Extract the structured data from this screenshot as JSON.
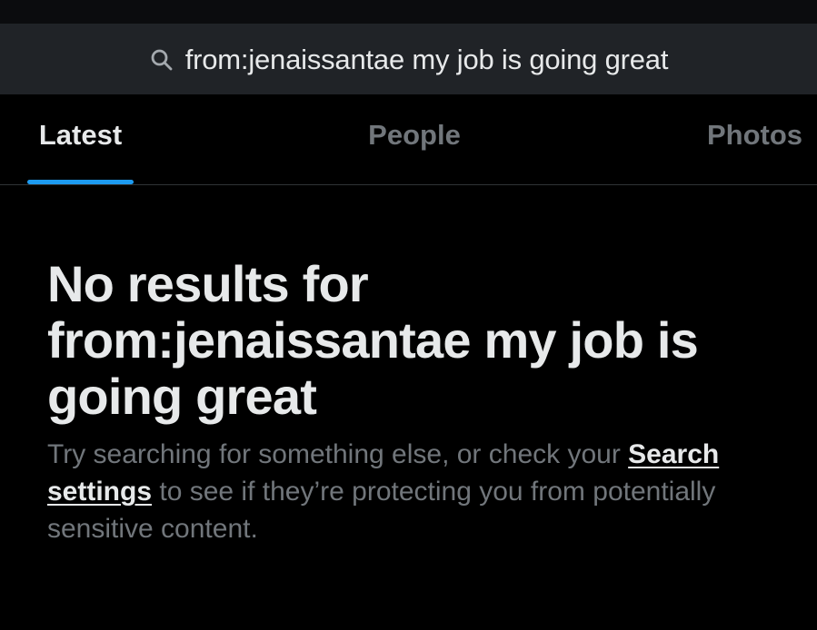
{
  "search": {
    "query": "from:jenaissantae my job is going great",
    "icon": "search-icon"
  },
  "tabs": [
    {
      "label": "Latest",
      "active": true
    },
    {
      "label": "People",
      "active": false
    },
    {
      "label": "Photos",
      "active": false
    }
  ],
  "empty_state": {
    "title": "No results for from:jenaissantae my job is going great",
    "body_before": "Try searching for something else, or check your ",
    "link_text": "Search settings",
    "body_after": " to see if they’re protecting you from potentially sensitive content."
  },
  "colors": {
    "background": "#000000",
    "search_bar": "#202327",
    "text_primary": "#e7e9ea",
    "text_secondary": "#71767b",
    "accent": "#1d9bf0",
    "divider": "#2f3336"
  }
}
